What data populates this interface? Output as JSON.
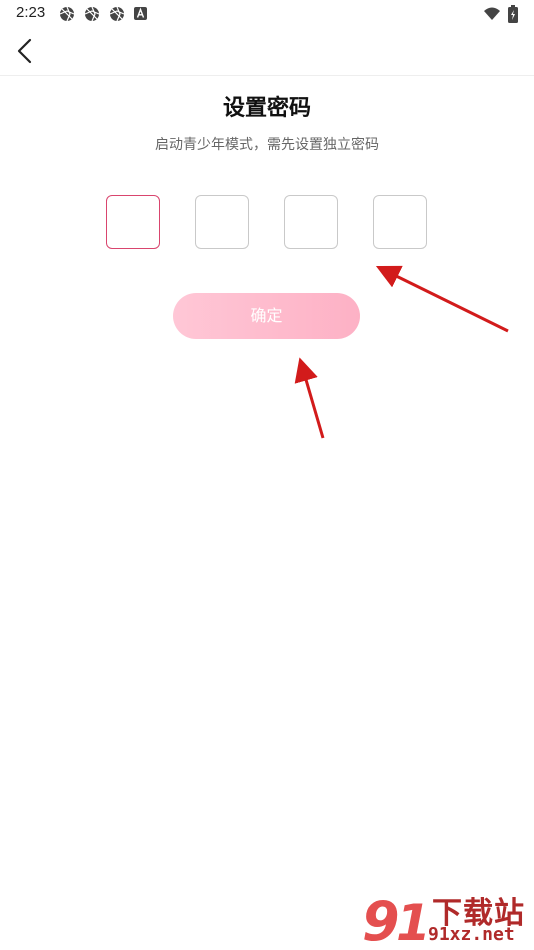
{
  "status_bar": {
    "time": "2:23",
    "icons": [
      "aperture-icon",
      "aperture-icon",
      "aperture-icon",
      "letter-a-icon",
      "wifi-icon",
      "battery-icon"
    ]
  },
  "nav": {
    "back_icon": "chevron-left-icon"
  },
  "main": {
    "title": "设置密码",
    "subtitle": "启动青少年模式，需先设置独立密码",
    "pin_boxes": [
      "",
      "",
      "",
      ""
    ],
    "confirm_label": "确定"
  },
  "colors": {
    "active_border": "#d9456e",
    "button_gradient_start": "#ffc7d6",
    "button_gradient_end": "#fdb1c5",
    "arrow": "#d21b1b"
  },
  "watermark": {
    "title": "下载站",
    "site": "91xz.net"
  }
}
